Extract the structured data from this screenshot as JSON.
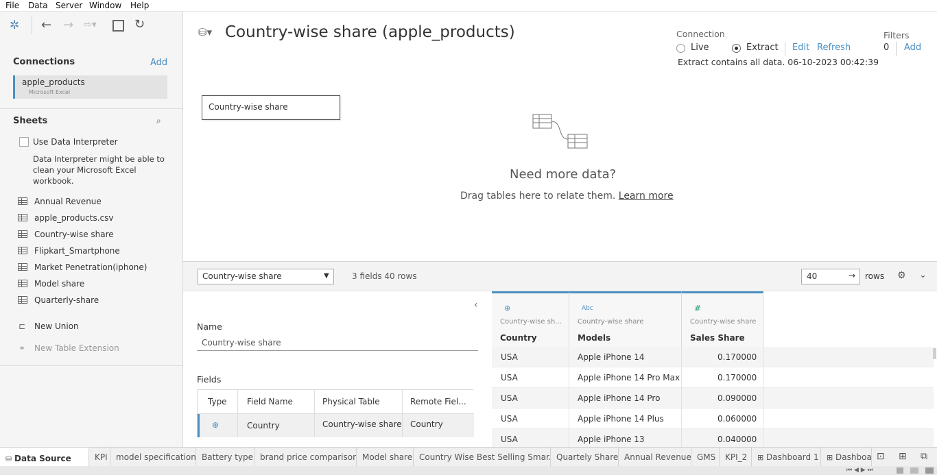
{
  "menu": [
    "File",
    "Data",
    "Server",
    "Window",
    "Help"
  ],
  "connections": {
    "heading": "Connections",
    "add_label": "Add",
    "items": [
      {
        "name": "apple_products",
        "type": "Microsoft Excel"
      }
    ]
  },
  "sheets": {
    "heading": "Sheets",
    "use_interpreter_label": "Use Data Interpreter",
    "interpreter_note": [
      "Data Interpreter might be able to",
      "clean your Microsoft Excel",
      "workbook."
    ],
    "items": [
      "Annual Revenue",
      "apple_products.csv",
      "Country-wise share",
      "Flipkart_Smartphone",
      "Market Penetration(iphone)",
      "Model share",
      "Quarterly-share"
    ],
    "new_union": "New Union",
    "new_table_extension": "New Table Extension"
  },
  "header": {
    "title": "Country-wise share (apple_products)",
    "connection_label": "Connection",
    "live_label": "Live",
    "extract_label": "Extract",
    "edit_label": "Edit",
    "refresh_label": "Refresh",
    "extract_note": "Extract contains all data. 06-10-2023 00:42:39",
    "filters_label": "Filters",
    "filters_count": "0",
    "filters_add": "Add"
  },
  "canvas": {
    "table_chip": "Country-wise share",
    "empty_title": "Need more data?",
    "empty_text": "Drag tables here to relate them.",
    "learn_more": "Learn more"
  },
  "gridbar": {
    "table_select": "Country-wise share",
    "summary": "3 fields 40 rows",
    "rows_value": "40",
    "rows_label": "rows"
  },
  "meta": {
    "name_label": "Name",
    "name_value": "Country-wise share",
    "fields_label": "Fields",
    "columns": [
      "Type",
      "Field Name",
      "Physical Table",
      "Remote Fiel..."
    ],
    "rows": [
      {
        "field": "Country",
        "table": "Country-wise share",
        "remote": "Country"
      }
    ]
  },
  "grid": {
    "columns": [
      {
        "type_icon": "globe-icon",
        "source": "Country-wise sh...",
        "name": "Country"
      },
      {
        "type_icon": "abc-icon",
        "source": "Country-wise share",
        "name": "Models"
      },
      {
        "type_icon": "number-icon",
        "source": "Country-wise share",
        "name": "Sales Share"
      }
    ],
    "abc_glyph": "Abc",
    "rows": [
      {
        "country": "USA",
        "model": "Apple iPhone 14",
        "share": "0.170000"
      },
      {
        "country": "USA",
        "model": "Apple iPhone 14 Pro Max",
        "share": "0.170000"
      },
      {
        "country": "USA",
        "model": "Apple iPhone 14 Pro",
        "share": "0.090000"
      },
      {
        "country": "USA",
        "model": "Apple iPhone 14 Plus",
        "share": "0.060000"
      },
      {
        "country": "USA",
        "model": "Apple iPhone 13",
        "share": "0.040000"
      }
    ]
  },
  "tabs": {
    "data_source": "Data Source",
    "items": [
      "KPI",
      "model specification",
      "Battery type",
      "brand price comparison",
      "Model share",
      "Country Wise Best Selling Smar...",
      "Quartely Share",
      "Annual Revenue",
      "GMS",
      "KPI_2",
      "Dashboard 1",
      "Dashboa"
    ]
  },
  "colors": {
    "accent": "#4a8fc2",
    "text": "#333333",
    "pane": "#f5f5f5"
  }
}
